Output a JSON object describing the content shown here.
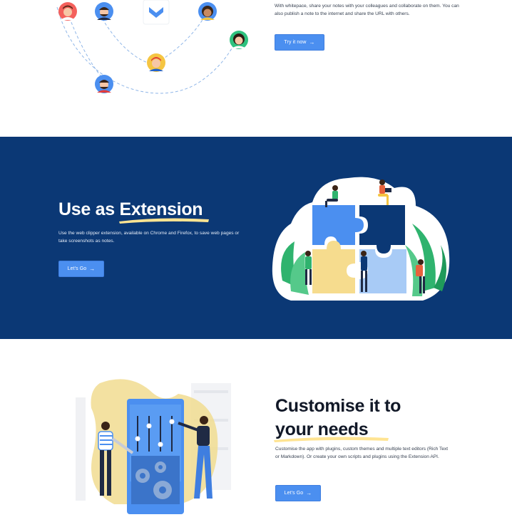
{
  "collaborate": {
    "description": "With whitepace, share your notes with your colleagues and collaborate on them. You can also publish a note to the internet and share the URL with others.",
    "button_label": "Try it now"
  },
  "extension": {
    "title_prefix": "Use as",
    "title_highlight": "Extension",
    "description": "Use the web clipper extension, available on Chrome and Firefox, to save web pages or take screenshots as notes.",
    "button_label": "Let's Go"
  },
  "customise": {
    "title_line1": "Customise it to",
    "title_highlight": "your needs",
    "description": "Customise the app with plugins, custom themes and multiple text editors (Rich Text or Markdown). Or create your own scripts and plugins using the Extension API.",
    "button_label": "Let's Go"
  },
  "icons": {
    "arrow": "→",
    "arrow_name": "arrow-right-icon",
    "logo_name": "whitepace-logo-icon"
  },
  "colors": {
    "navy": "#0b3875",
    "accent_blue": "#4b8ff0",
    "highlight_yellow": "#ffe492"
  }
}
